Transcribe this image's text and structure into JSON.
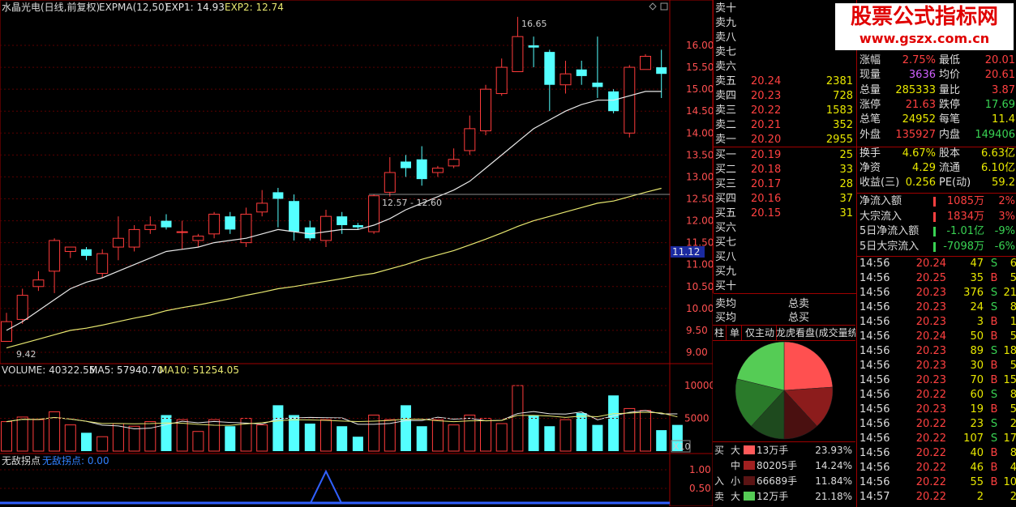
{
  "main": {
    "title": "水晶光电(日线,前复权)",
    "indicator": "EXPMA(12,50)",
    "exp1": "EXP1: 14.93",
    "exp2": "EXP2: 12.74",
    "y_ticks": [
      "16.00",
      "15.50",
      "15.00",
      "14.50",
      "14.00",
      "13.50",
      "13.00",
      "12.50",
      "12.00",
      "11.50",
      "11.00",
      "10.50",
      "10.00",
      "9.50",
      "9.00"
    ],
    "price_tag": "11.12",
    "annotation_high": "16.65",
    "annotation_low": "9.42",
    "annotation_range": "12.57 - 12.60",
    "corner_icons": [
      "diamond-icon",
      "square-icon"
    ]
  },
  "volume": {
    "title": "VOLUME: 40322.55",
    "ma5": "MA5: 57940.70",
    "ma10": "MA10: 51254.05",
    "y_ticks": [
      "10000",
      "5000"
    ],
    "scale_label": "X10"
  },
  "indicator_panel": {
    "name": "无敌拐点",
    "value_label": "无敌拐点: 0.00",
    "y_ticks": [
      "1.00",
      "0.50"
    ]
  },
  "candles": [
    {
      "o": 9.25,
      "c": 9.7,
      "h": 9.9,
      "l": 9.42
    },
    {
      "o": 9.75,
      "c": 10.3,
      "h": 10.45,
      "l": 9.65
    },
    {
      "o": 10.5,
      "c": 10.65,
      "h": 10.85,
      "l": 10.4
    },
    {
      "o": 10.85,
      "c": 11.55,
      "h": 11.6,
      "l": 10.35
    },
    {
      "o": 11.3,
      "c": 11.4,
      "h": 11.4,
      "l": 11.15
    },
    {
      "o": 11.35,
      "c": 11.2,
      "h": 11.4,
      "l": 11.1
    },
    {
      "o": 10.8,
      "c": 11.25,
      "h": 11.35,
      "l": 10.7
    },
    {
      "o": 11.4,
      "c": 11.6,
      "h": 12.1,
      "l": 11.1
    },
    {
      "o": 11.4,
      "c": 11.8,
      "h": 11.9,
      "l": 11.3
    },
    {
      "o": 11.8,
      "c": 11.9,
      "h": 12.1,
      "l": 11.7
    },
    {
      "o": 12.0,
      "c": 11.85,
      "h": 12.15,
      "l": 11.8
    },
    {
      "o": 11.75,
      "c": 11.75,
      "h": 12.0,
      "l": 11.35
    },
    {
      "o": 11.55,
      "c": 11.65,
      "h": 11.7,
      "l": 11.4
    },
    {
      "o": 11.7,
      "c": 12.15,
      "h": 12.2,
      "l": 11.6
    },
    {
      "o": 12.1,
      "c": 11.8,
      "h": 12.2,
      "l": 11.7
    },
    {
      "o": 11.5,
      "c": 12.15,
      "h": 12.3,
      "l": 11.4
    },
    {
      "o": 12.2,
      "c": 12.4,
      "h": 12.7,
      "l": 12.1
    },
    {
      "o": 12.65,
      "c": 12.5,
      "h": 12.75,
      "l": 11.85
    },
    {
      "o": 12.45,
      "c": 11.75,
      "h": 12.6,
      "l": 11.55
    },
    {
      "o": 11.85,
      "c": 11.6,
      "h": 12.0,
      "l": 11.55
    },
    {
      "o": 11.55,
      "c": 12.1,
      "h": 12.25,
      "l": 11.4
    },
    {
      "o": 12.1,
      "c": 11.9,
      "h": 12.2,
      "l": 11.7
    },
    {
      "o": 11.9,
      "c": 11.85,
      "h": 11.95,
      "l": 11.8
    },
    {
      "o": 11.75,
      "c": 12.57,
      "h": 12.6,
      "l": 11.7
    },
    {
      "o": 12.65,
      "c": 13.1,
      "h": 13.45,
      "l": 12.55
    },
    {
      "o": 13.35,
      "c": 13.2,
      "h": 13.5,
      "l": 13.0
    },
    {
      "o": 13.4,
      "c": 12.95,
      "h": 13.7,
      "l": 12.8
    },
    {
      "o": 13.1,
      "c": 13.2,
      "h": 13.25,
      "l": 13.0
    },
    {
      "o": 13.25,
      "c": 13.4,
      "h": 13.65,
      "l": 13.2
    },
    {
      "o": 13.6,
      "c": 14.1,
      "h": 14.4,
      "l": 13.5
    },
    {
      "o": 14.05,
      "c": 15.0,
      "h": 15.1,
      "l": 13.95
    },
    {
      "o": 14.9,
      "c": 15.5,
      "h": 15.7,
      "l": 14.85
    },
    {
      "o": 15.4,
      "c": 16.2,
      "h": 16.65,
      "l": 15.4
    },
    {
      "o": 16.0,
      "c": 15.95,
      "h": 16.2,
      "l": 15.5
    },
    {
      "o": 15.85,
      "c": 15.1,
      "h": 15.9,
      "l": 14.5
    },
    {
      "o": 15.1,
      "c": 15.35,
      "h": 15.65,
      "l": 14.9
    },
    {
      "o": 15.45,
      "c": 15.3,
      "h": 15.65,
      "l": 15.1
    },
    {
      "o": 15.15,
      "c": 15.05,
      "h": 16.2,
      "l": 14.8
    },
    {
      "o": 14.95,
      "c": 14.5,
      "h": 15.0,
      "l": 14.45
    },
    {
      "o": 14.0,
      "c": 15.5,
      "h": 15.55,
      "l": 13.9
    },
    {
      "o": 15.45,
      "c": 15.75,
      "h": 15.8,
      "l": 15.45
    },
    {
      "o": 15.5,
      "c": 15.35,
      "h": 15.9,
      "l": 14.8
    }
  ],
  "volumes": [
    45,
    52,
    48,
    60,
    40,
    28,
    22,
    42,
    38,
    45,
    55,
    48,
    30,
    48,
    38,
    50,
    40,
    70,
    55,
    42,
    48,
    38,
    22,
    55,
    48,
    70,
    38,
    48,
    40,
    55,
    50,
    42,
    100,
    55,
    38,
    48,
    58,
    40,
    85,
    65,
    62,
    32,
    40
  ],
  "exp1_points": [
    9.5,
    9.7,
    9.95,
    10.2,
    10.45,
    10.6,
    10.7,
    10.85,
    11.0,
    11.15,
    11.3,
    11.35,
    11.4,
    11.5,
    11.55,
    11.6,
    11.7,
    11.8,
    11.75,
    11.7,
    11.75,
    11.8,
    11.8,
    11.9,
    12.05,
    12.25,
    12.4,
    12.55,
    12.7,
    12.9,
    13.2,
    13.5,
    13.8,
    14.1,
    14.3,
    14.5,
    14.65,
    14.75,
    14.75,
    14.85,
    14.95,
    14.95
  ],
  "exp2_points": [
    9.1,
    9.2,
    9.3,
    9.4,
    9.5,
    9.55,
    9.62,
    9.7,
    9.78,
    9.85,
    9.95,
    10.02,
    10.08,
    10.15,
    10.22,
    10.3,
    10.37,
    10.45,
    10.5,
    10.56,
    10.62,
    10.68,
    10.75,
    10.8,
    10.9,
    11.0,
    11.12,
    11.22,
    11.32,
    11.45,
    11.58,
    11.72,
    11.87,
    12.0,
    12.1,
    12.2,
    12.3,
    12.4,
    12.45,
    12.55,
    12.65,
    12.74
  ],
  "orderbook": {
    "sell": [
      {
        "label": "卖十",
        "price": "",
        "vol": ""
      },
      {
        "label": "卖九",
        "price": "",
        "vol": ""
      },
      {
        "label": "卖八",
        "price": "",
        "vol": ""
      },
      {
        "label": "卖七",
        "price": "",
        "vol": ""
      },
      {
        "label": "卖六",
        "price": "",
        "vol": ""
      },
      {
        "label": "卖五",
        "price": "20.24",
        "vol": "2381"
      },
      {
        "label": "卖四",
        "price": "20.23",
        "vol": "728"
      },
      {
        "label": "卖三",
        "price": "20.22",
        "vol": "1583"
      },
      {
        "label": "卖二",
        "price": "20.21",
        "vol": "352"
      },
      {
        "label": "卖一",
        "price": "20.20",
        "vol": "2955"
      }
    ],
    "buy": [
      {
        "label": "买一",
        "price": "20.19",
        "vol": "25"
      },
      {
        "label": "买二",
        "price": "20.18",
        "vol": "33"
      },
      {
        "label": "买三",
        "price": "20.17",
        "vol": "28"
      },
      {
        "label": "买四",
        "price": "20.16",
        "vol": "37"
      },
      {
        "label": "买五",
        "price": "20.15",
        "vol": "31"
      },
      {
        "label": "买六",
        "price": "",
        "vol": ""
      },
      {
        "label": "买七",
        "price": "",
        "vol": ""
      },
      {
        "label": "买八",
        "price": "",
        "vol": ""
      },
      {
        "label": "买九",
        "price": "",
        "vol": ""
      },
      {
        "label": "买十",
        "price": "",
        "vol": ""
      }
    ],
    "avg_sell_label": "卖均",
    "avg_buy_label": "买均",
    "total_sell_label": "总卖",
    "total_buy_label": "总买"
  },
  "tabs": [
    "柱",
    "单",
    "仅主动",
    "龙虎看盘(成交量统"
  ],
  "flow_table": [
    {
      "side": "买",
      "size": "大",
      "vol": "13万手",
      "pct": "23.93%",
      "color": "#ff5a5a"
    },
    {
      "side": "",
      "size": "中",
      "vol": "80205手",
      "pct": "14.24%",
      "color": "#a02020"
    },
    {
      "side": "入",
      "size": "小",
      "vol": "66689手",
      "pct": "11.84%",
      "color": "#5a1414"
    },
    {
      "side": "卖",
      "size": "大",
      "vol": "12万手",
      "pct": "21.18%",
      "color": "#55cc55"
    }
  ],
  "pie": [
    {
      "value": 23.93,
      "color": "#ff5050"
    },
    {
      "value": 14.24,
      "color": "#8c1c1c"
    },
    {
      "value": 11.84,
      "color": "#4a1010"
    },
    {
      "value": 11.8,
      "color": "#1e4a1e"
    },
    {
      "value": 17.0,
      "color": "#2a7a2a"
    },
    {
      "value": 21.18,
      "color": "#55cc55"
    }
  ],
  "stats": [
    {
      "k1": "涨幅",
      "v1": "2.75%",
      "c1": "red",
      "k2": "最低",
      "v2": "20.01",
      "c2": "red"
    },
    {
      "k1": "现量",
      "v1": "3636",
      "c1": "purple",
      "k2": "均价",
      "v2": "20.61",
      "c2": "red"
    },
    {
      "k1": "总量",
      "v1": "285333",
      "c1": "yellow",
      "k2": "量比",
      "v2": "3.87",
      "c2": "red"
    },
    {
      "k1": "涨停",
      "v1": "21.63",
      "c1": "red",
      "k2": "跌停",
      "v2": "17.69",
      "c2": "green"
    },
    {
      "k1": "总笔",
      "v1": "24952",
      "c1": "yellow",
      "k2": "每笔",
      "v2": "11.4",
      "c2": "yellow"
    },
    {
      "k1": "外盘",
      "v1": "135927",
      "c1": "red",
      "k2": "内盘",
      "v2": "149406",
      "c2": "green"
    },
    {
      "k1": "换手",
      "v1": "4.67%",
      "c1": "yellow",
      "k2": "股本",
      "v2": "6.63亿",
      "c2": "yellow"
    },
    {
      "k1": "净资",
      "v1": "4.29",
      "c1": "yellow",
      "k2": "流通",
      "v2": "6.10亿",
      "c2": "yellow"
    },
    {
      "k1": "收益(三)",
      "v1": "0.256",
      "c1": "yellow",
      "k2": "PE(动)",
      "v2": "59.2",
      "c2": "yellow"
    }
  ],
  "flows": [
    {
      "label": "净流入额",
      "value": "1085万",
      "pct": "2%",
      "color": "red"
    },
    {
      "label": "大宗流入",
      "value": "1834万",
      "pct": "3%",
      "color": "red"
    },
    {
      "label": "5日净流入额",
      "value": "-1.01亿",
      "pct": "-9%",
      "color": "green"
    },
    {
      "label": "5日大宗流入",
      "value": "-7098万",
      "pct": "-6%",
      "color": "green"
    }
  ],
  "ticks": [
    {
      "t": "14:56",
      "p": "20.24",
      "v": "47",
      "s": "S",
      "n": "6",
      "pc": "red"
    },
    {
      "t": "14:56",
      "p": "20.25",
      "v": "35",
      "s": "B",
      "n": "5",
      "pc": "red"
    },
    {
      "t": "14:56",
      "p": "20.23",
      "v": "376",
      "s": "S",
      "n": "21",
      "pc": "red"
    },
    {
      "t": "14:56",
      "p": "20.23",
      "v": "24",
      "s": "S",
      "n": "8",
      "pc": "red"
    },
    {
      "t": "14:56",
      "p": "20.23",
      "v": "3",
      "s": "B",
      "n": "1",
      "pc": "red"
    },
    {
      "t": "14:56",
      "p": "20.24",
      "v": "50",
      "s": "B",
      "n": "5",
      "pc": "red"
    },
    {
      "t": "14:56",
      "p": "20.23",
      "v": "89",
      "s": "S",
      "n": "18",
      "pc": "red"
    },
    {
      "t": "14:56",
      "p": "20.23",
      "v": "30",
      "s": "B",
      "n": "5",
      "pc": "red"
    },
    {
      "t": "14:56",
      "p": "20.23",
      "v": "70",
      "s": "B",
      "n": "15",
      "pc": "red"
    },
    {
      "t": "14:56",
      "p": "20.22",
      "v": "60",
      "s": "S",
      "n": "8",
      "pc": "red"
    },
    {
      "t": "14:56",
      "p": "20.23",
      "v": "19",
      "s": "B",
      "n": "5",
      "pc": "red"
    },
    {
      "t": "14:56",
      "p": "20.22",
      "v": "23",
      "s": "S",
      "n": "2",
      "pc": "red"
    },
    {
      "t": "14:56",
      "p": "20.22",
      "v": "107",
      "s": "S",
      "n": "17",
      "pc": "red"
    },
    {
      "t": "14:56",
      "p": "20.22",
      "v": "40",
      "s": "B",
      "n": "8",
      "pc": "red"
    },
    {
      "t": "14:56",
      "p": "20.22",
      "v": "46",
      "s": "B",
      "n": "4",
      "pc": "red"
    },
    {
      "t": "14:56",
      "p": "20.22",
      "v": "55",
      "s": "B",
      "n": "10",
      "pc": "red"
    },
    {
      "t": "14:57",
      "p": "20.22",
      "v": "2",
      "s": "",
      "n": "2",
      "pc": "red"
    }
  ],
  "logo": {
    "text": "股票公式指标网",
    "url": "www.gszx.com.cn"
  }
}
